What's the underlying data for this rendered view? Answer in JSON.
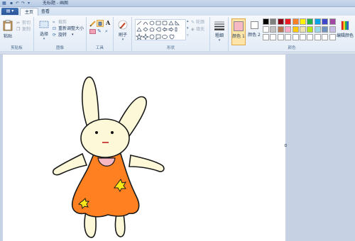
{
  "window": {
    "title": "无标题 - 画图"
  },
  "app_menu": {
    "label": "▤ ▾"
  },
  "tabs": [
    {
      "label": "主页"
    },
    {
      "label": "查看"
    }
  ],
  "clipboard": {
    "paste_label": "粘贴",
    "cut_label": "剪切",
    "copy_label": "复制",
    "group_label": "剪贴板"
  },
  "image": {
    "select_label": "选择",
    "crop_label": "裁剪",
    "resize_label": "重新调整大小",
    "rotate_label": "旋转",
    "group_label": "图像"
  },
  "tools": {
    "group_label": "工具"
  },
  "brushes": {
    "label": "刷子"
  },
  "shapes": {
    "outline_label": "轮廓",
    "fill_label": "填充",
    "group_label": "形状"
  },
  "size": {
    "label": "粗细"
  },
  "colors": {
    "color1_label": "颜色 1",
    "color2_label": "颜色 2",
    "edit_label": "编辑颜色",
    "group_label": "颜色",
    "color1": "#f7b7c3",
    "color2": "#ffffff",
    "palette_row1": [
      "#000000",
      "#7f7f7f",
      "#880015",
      "#ed1c24",
      "#ff7f27",
      "#fff200",
      "#22b14c",
      "#00a2e8",
      "#3f48cc",
      "#a349a4"
    ],
    "palette_row2": [
      "#ffffff",
      "#c3c3c3",
      "#b97a57",
      "#ffaec9",
      "#ffc90e",
      "#efe4b0",
      "#b5e61d",
      "#99d9ea",
      "#7092be",
      "#c8bfe7"
    ],
    "palette_row3": [
      "#ffffff",
      "#ffffff",
      "#ffffff",
      "#ffffff",
      "#ffffff",
      "#ffffff",
      "#ffffff",
      "#ffffff",
      "#ffffff",
      "#ffffff"
    ]
  },
  "drawing": {
    "subject": "rabbit",
    "ear_color": "#fdf8d8",
    "dress_color": "#ff8021",
    "collar_color": "#f7b7c3",
    "flower_color": "#ffe81a"
  }
}
